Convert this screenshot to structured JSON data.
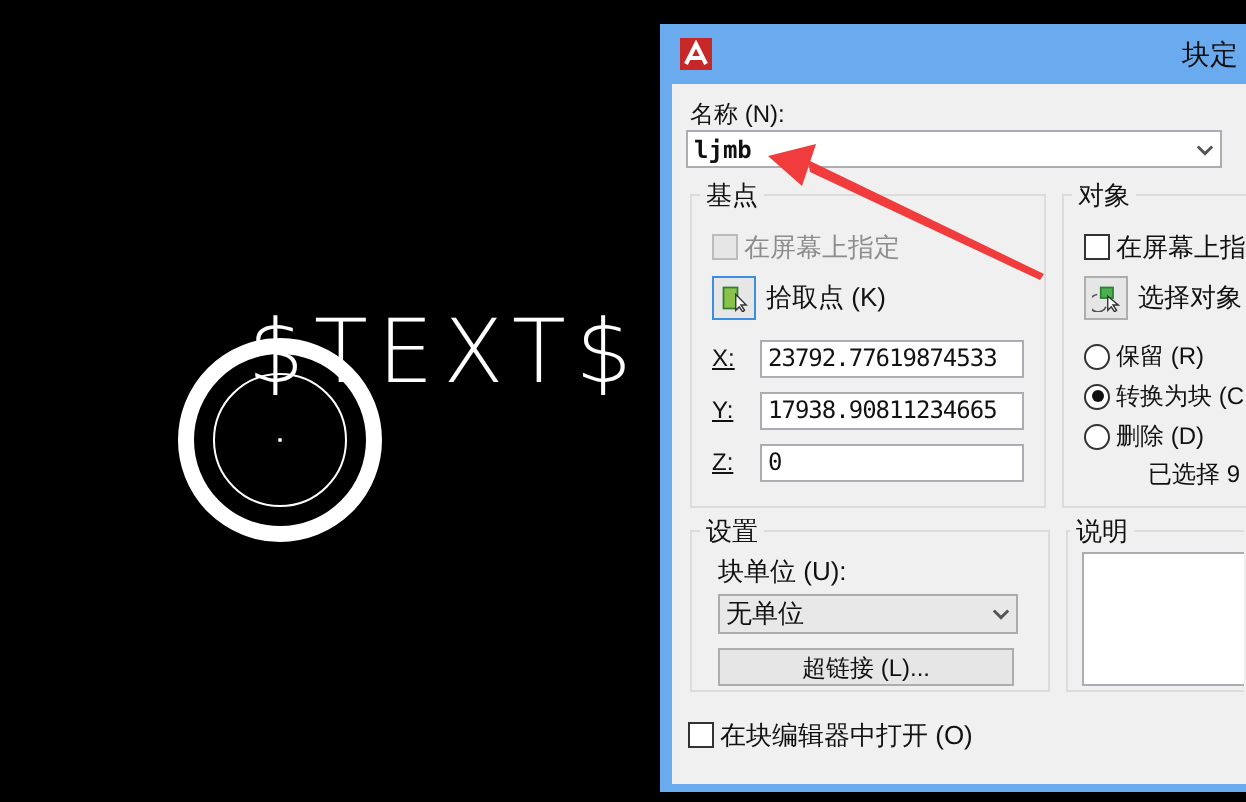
{
  "canvas": {
    "text": "$TEXT$"
  },
  "dialog": {
    "title": "块定",
    "name": {
      "label": "名称 (N):",
      "value": "ljmb"
    },
    "base_point": {
      "title": "基点",
      "specify_on_screen": {
        "label": "在屏幕上指定",
        "checked": false,
        "disabled": true
      },
      "pick_button": "拾取点 (K)",
      "coords": [
        {
          "label": "X:",
          "value": "23792.77619874533"
        },
        {
          "label": "Y:",
          "value": "17938.90811234665"
        },
        {
          "label": "Z:",
          "value": "0"
        }
      ]
    },
    "objects": {
      "title": "对象",
      "specify_on_screen": {
        "label": "在屏幕上指",
        "checked": false,
        "disabled": false
      },
      "select_button": "选择对象",
      "options": [
        {
          "label": "保留 (R)",
          "selected": false
        },
        {
          "label": "转换为块 (C",
          "selected": true
        },
        {
          "label": "删除 (D)",
          "selected": false
        }
      ],
      "selection_count": "已选择 9"
    },
    "settings": {
      "title": "设置",
      "unit_label": "块单位 (U):",
      "unit_value": "无单位",
      "hyperlink_button": "超链接 (L)..."
    },
    "description": {
      "title": "说明"
    },
    "open_in_editor": {
      "label": "在块编辑器中打开 (O)",
      "checked": false
    }
  }
}
